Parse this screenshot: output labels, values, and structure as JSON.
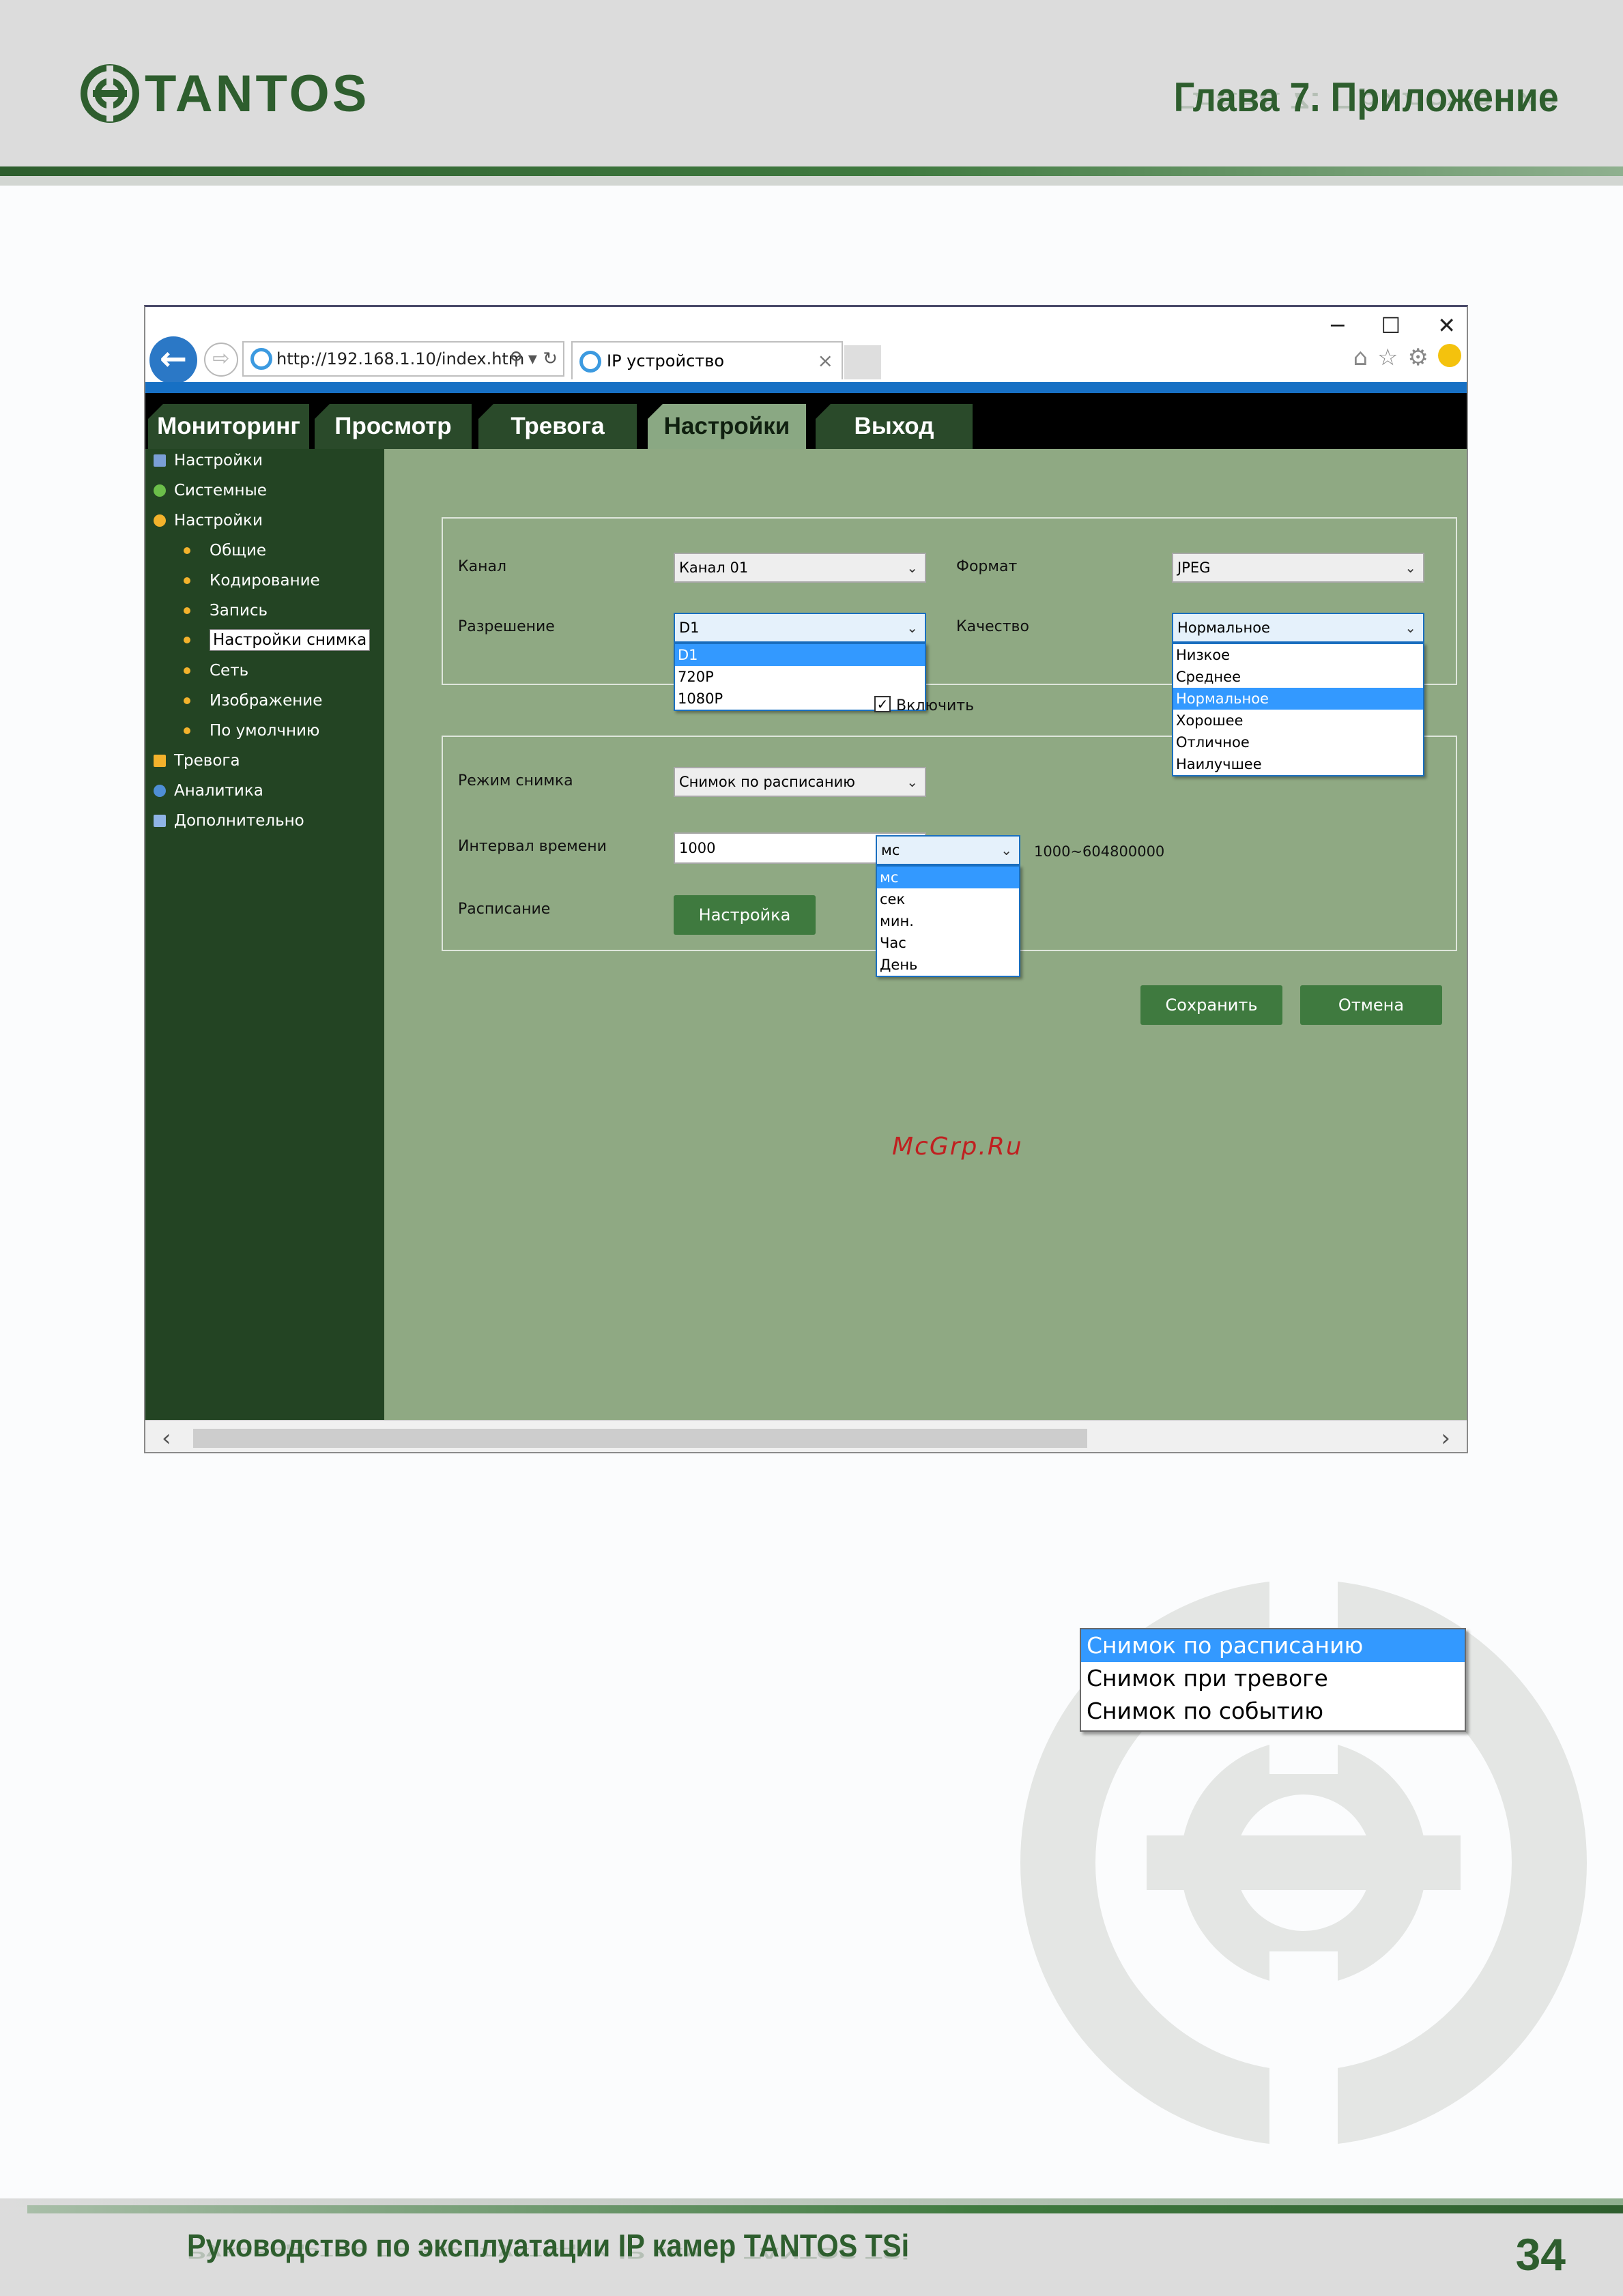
{
  "header": {
    "logo_text": "TANTOS",
    "chapter_title": "Глава 7. Приложение"
  },
  "browser": {
    "address": "http://192.168.1.10/index.htm",
    "address_tools": "⚲ ▾ ↻",
    "tab_title": "IP устройство",
    "tab_close": "×",
    "window_controls": {
      "minimize": "─",
      "maximize": "☐",
      "close": "✕"
    },
    "toolbar_icons": {
      "home": "⌂",
      "favorites": "☆",
      "settings": "⚙"
    }
  },
  "nav": {
    "tabs": [
      {
        "label": "Мониторинг"
      },
      {
        "label": "Просмотр"
      },
      {
        "label": "Тревога"
      },
      {
        "label": "Настройки",
        "active": true
      },
      {
        "label": "Выход"
      }
    ]
  },
  "sidebar": {
    "items": [
      {
        "label": "Настройки"
      },
      {
        "label": "Системные"
      },
      {
        "label": "Настройки"
      },
      {
        "label": "Общие"
      },
      {
        "label": "Кодирование"
      },
      {
        "label": "Запись"
      },
      {
        "label": "Настройки снимка",
        "selected": true
      },
      {
        "label": "Сеть"
      },
      {
        "label": "Изображение"
      },
      {
        "label": "По умолчнию"
      },
      {
        "label": "Тревога"
      },
      {
        "label": "Аналитика"
      },
      {
        "label": "Дополнительно"
      }
    ]
  },
  "form": {
    "channel_label": "Канал",
    "channel_value": "Канал 01",
    "format_label": "Формат",
    "format_value": "JPEG",
    "resolution_label": "Разрешение",
    "resolution_value": "D1",
    "resolution_options": [
      "D1",
      "720P",
      "1080P"
    ],
    "quality_label": "Качество",
    "quality_value": "Нормальное",
    "quality_options": [
      "Низкое",
      "Среднее",
      "Нормальное",
      "Хорошее",
      "Отличное",
      "Наилучшее"
    ],
    "mode_label": "Режим снимка",
    "mode_value": "Снимок по расписанию",
    "enable_label": "Включить",
    "enable_checked": true,
    "interval_label": "Интервал времени",
    "interval_value": "1000",
    "unit_value": "мс",
    "unit_options": [
      "мс",
      "сек",
      "мин.",
      "Час",
      "День"
    ],
    "range_text": "1000~604800000",
    "schedule_label": "Расписание",
    "setup_button": "Настройка",
    "save_button": "Сохранить",
    "cancel_button": "Отмена"
  },
  "watermark_text": "McGrp.Ru",
  "mode_list": {
    "options": [
      "Снимок по расписанию",
      "Снимок при тревоге",
      "Снимок по событию"
    ],
    "selected_index": 0
  },
  "footer": {
    "text": "Руководство по эксплуатации IP камер TANTOS TSi",
    "page_number": "34"
  },
  "colors": {
    "brand_green": "#2e5e2e",
    "content_bg": "#8fa983",
    "sidebar_bg": "#234423",
    "selection_blue": "#3399ff"
  }
}
